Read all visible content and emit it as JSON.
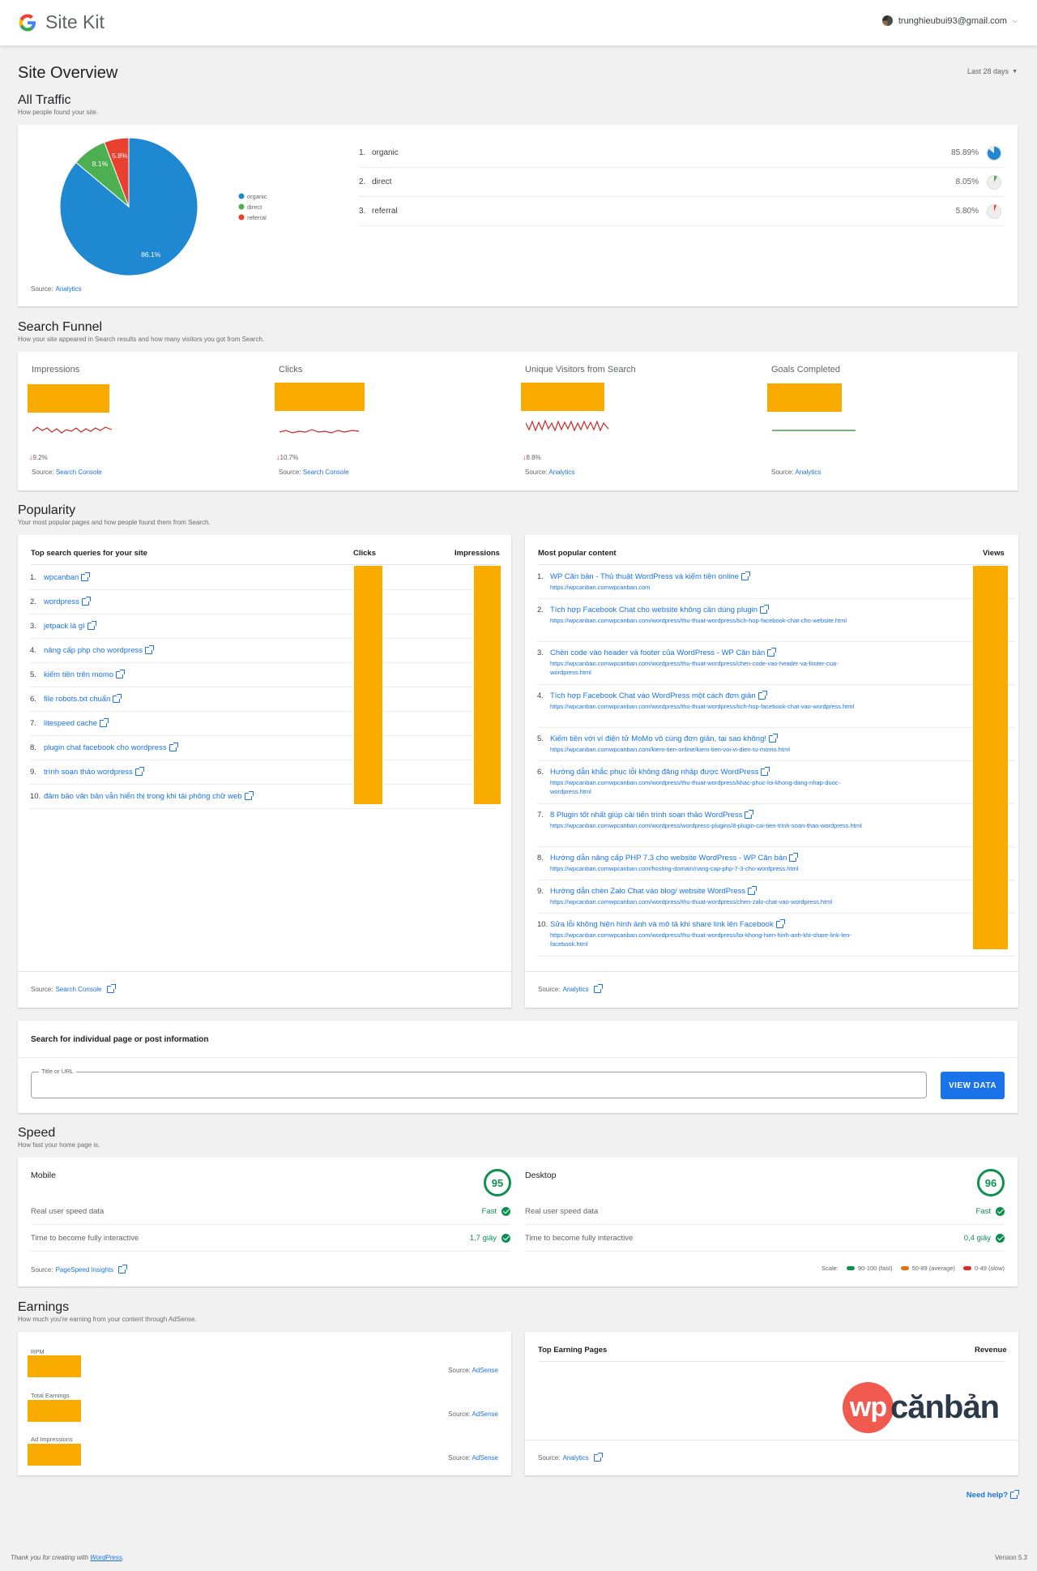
{
  "header": {
    "brand": "Site Kit",
    "account": "trunghieubui93@gmail.com"
  },
  "page": {
    "title": "Site Overview",
    "date_range": "Last 28 days"
  },
  "all_traffic": {
    "title": "All Traffic",
    "subtitle": "How people found your site.",
    "source_prefix": "Source:",
    "source": "Analytics",
    "colors": {
      "organic": "#1e88d0",
      "direct": "#4caf50",
      "referral": "#e8412f"
    },
    "chart_data": {
      "type": "pie",
      "categories": [
        "organic",
        "direct",
        "referral"
      ],
      "values": [
        86.1,
        8.1,
        5.8
      ],
      "slice_labels": [
        "86.1%",
        "8.1%",
        "5.8%"
      ],
      "legend": [
        "organic",
        "direct",
        "referral"
      ]
    },
    "rows": [
      {
        "num": "1.",
        "label": "organic",
        "pct": "85.89%",
        "value": 85.89
      },
      {
        "num": "2.",
        "label": "direct",
        "pct": "8.05%",
        "value": 8.05
      },
      {
        "num": "3.",
        "label": "referral",
        "pct": "5.80%",
        "value": 5.8
      }
    ]
  },
  "search_funnel": {
    "title": "Search Funnel",
    "subtitle": "How your site appeared in Search results and how many visitors you got from Search.",
    "columns": [
      {
        "label": "Impressions",
        "delta": "9.2%",
        "source": "Search Console"
      },
      {
        "label": "Clicks",
        "delta": "10.7%",
        "source": "Search Console"
      },
      {
        "label": "Unique Visitors from Search",
        "delta": "8.8%",
        "source": "Analytics"
      },
      {
        "label": "Goals Completed",
        "delta": "",
        "source": "Analytics"
      }
    ]
  },
  "popularity": {
    "title": "Popularity",
    "subtitle": "Your most popular pages and how people found them from Search.",
    "queries": {
      "header": "Top search queries for your site",
      "col_clicks": "Clicks",
      "col_impressions": "Impressions",
      "source": "Search Console",
      "items": [
        {
          "num": "1.",
          "text": "wpcanban"
        },
        {
          "num": "2.",
          "text": "wordpress"
        },
        {
          "num": "3.",
          "text": "jetpack là gì"
        },
        {
          "num": "4.",
          "text": "nâng cấp php cho wordpress"
        },
        {
          "num": "5.",
          "text": "kiếm tiền trên momo"
        },
        {
          "num": "6.",
          "text": "file robots.txt chuẩn"
        },
        {
          "num": "7.",
          "text": "litespeed cache"
        },
        {
          "num": "8.",
          "text": "plugin chat facebook cho wordpress"
        },
        {
          "num": "9.",
          "text": "trình soạn thảo wordpress"
        },
        {
          "num": "10.",
          "text": "đảm bảo văn bản vẫn hiển thị trong khi tải phông chữ web"
        }
      ]
    },
    "content": {
      "header": "Most popular content",
      "col_views": "Views",
      "source": "Analytics",
      "items": [
        {
          "num": "1.",
          "title": "WP Căn bản - Thủ thuật WordPress và kiếm tiền online",
          "url": "https://wpcanban.comwpcanban.com"
        },
        {
          "num": "2.",
          "title": "Tích hợp Facebook Chat cho website không cần dùng plugin",
          "url": "https://wpcanban.comwpcanban.com/wordpress/thu-thuat-wordpress/tich-hop-facebook-chat-cho-website.html"
        },
        {
          "num": "3.",
          "title": "Chèn code vào header và footer của WordPress - WP Căn bản",
          "url": "https://wpcanban.comwpcanban.com/wordpress/thu-thuat-wordpress/chen-code-vao-header-va-footer-cua-wordpress.html"
        },
        {
          "num": "4.",
          "title": "Tích hợp Facebook Chat vào WordPress một cách đơn giản",
          "url": "https://wpcanban.comwpcanban.com/wordpress/thu-thuat-wordpress/tich-hop-facebook-chat-vao-wordpress.html"
        },
        {
          "num": "5.",
          "title": "Kiếm tiền với ví điện tử MoMo vô cùng đơn giản, tại sao không!",
          "url": "https://wpcanban.comwpcanban.com/kiem-tien-online/kiem-tien-voi-vi-dien-tu-momo.html"
        },
        {
          "num": "6.",
          "title": "Hướng dẫn khắc phục lỗi không đăng nhập được WordPress",
          "url": "https://wpcanban.comwpcanban.com/wordpress/thu-thuat-wordpress/khac-phuc-loi-khong-dang-nhap-duoc-wordpress.html"
        },
        {
          "num": "7.",
          "title": "8 Plugin tốt nhất giúp cải tiến trình soạn thảo WordPress",
          "url": "https://wpcanban.comwpcanban.com/wordpress/wordpress-plugins/8-plugin-cai-tien-trinh-soan-thao-wordpress.html"
        },
        {
          "num": "8.",
          "title": "Hướng dẫn nâng cấp PHP 7.3 cho website WordPress - WP Căn bản",
          "url": "https://wpcanban.comwpcanban.com/hosting-domain/nang-cap-php-7-3-cho-wordpress.html"
        },
        {
          "num": "9.",
          "title": "Hướng dẫn chèn Zalo Chat vào blog/ website WordPress",
          "url": "https://wpcanban.comwpcanban.com/wordpress/thu-thuat-wordpress/chen-zalo-chat-vao-wordpress.html"
        },
        {
          "num": "10.",
          "title": "Sửa lỗi không hiện hình ảnh và mô tả khi share link lên Facebook",
          "url": "https://wpcanban.comwpcanban.com/wordpress/thu-thuat-wordpress/loi-khong-hien-hinh-anh-khi-share-link-len-facebook.html"
        }
      ]
    }
  },
  "search_card": {
    "title": "Search for individual page or post information",
    "input_label": "Title or URL",
    "input_value": "",
    "button": "VIEW DATA"
  },
  "speed": {
    "title": "Speed",
    "subtitle": "How fast your home page is.",
    "mobile": {
      "label": "Mobile",
      "score": "95",
      "real_user": "Real user speed data",
      "real_user_value": "Fast",
      "tti": "Time to become fully interactive",
      "tti_value": "1,7 giây"
    },
    "desktop": {
      "label": "Desktop",
      "score": "96",
      "real_user": "Real user speed data",
      "real_user_value": "Fast",
      "tti": "Time to become fully interactive",
      "tti_value": "0,4 giây"
    },
    "source": "PageSpeed Insights",
    "scale_label": "Scale:",
    "scale": [
      {
        "label": "90-100 (fast)",
        "color": "#0d904f"
      },
      {
        "label": "50-89 (average)",
        "color": "#e8710a"
      },
      {
        "label": "0-49 (slow)",
        "color": "#d93025"
      }
    ]
  },
  "earnings": {
    "title": "Earnings",
    "subtitle": "How much you're earning from your content through AdSense.",
    "metrics": [
      {
        "label": "RPM",
        "source": "AdSense"
      },
      {
        "label": "Total Earnings",
        "source": "AdSense"
      },
      {
        "label": "Ad Impressions",
        "source": "AdSense"
      }
    ],
    "top_pages": {
      "header": "Top Earning Pages",
      "col_revenue": "Revenue",
      "source": "Analytics",
      "watermark_a": "wp",
      "watermark_b": "cănbản"
    }
  },
  "source_prefix": "Source:",
  "help": "Need help?",
  "footer": {
    "thanks_prefix": "Thank you for creating with",
    "thanks_link": "WordPress",
    "version": "Version 5.3"
  }
}
